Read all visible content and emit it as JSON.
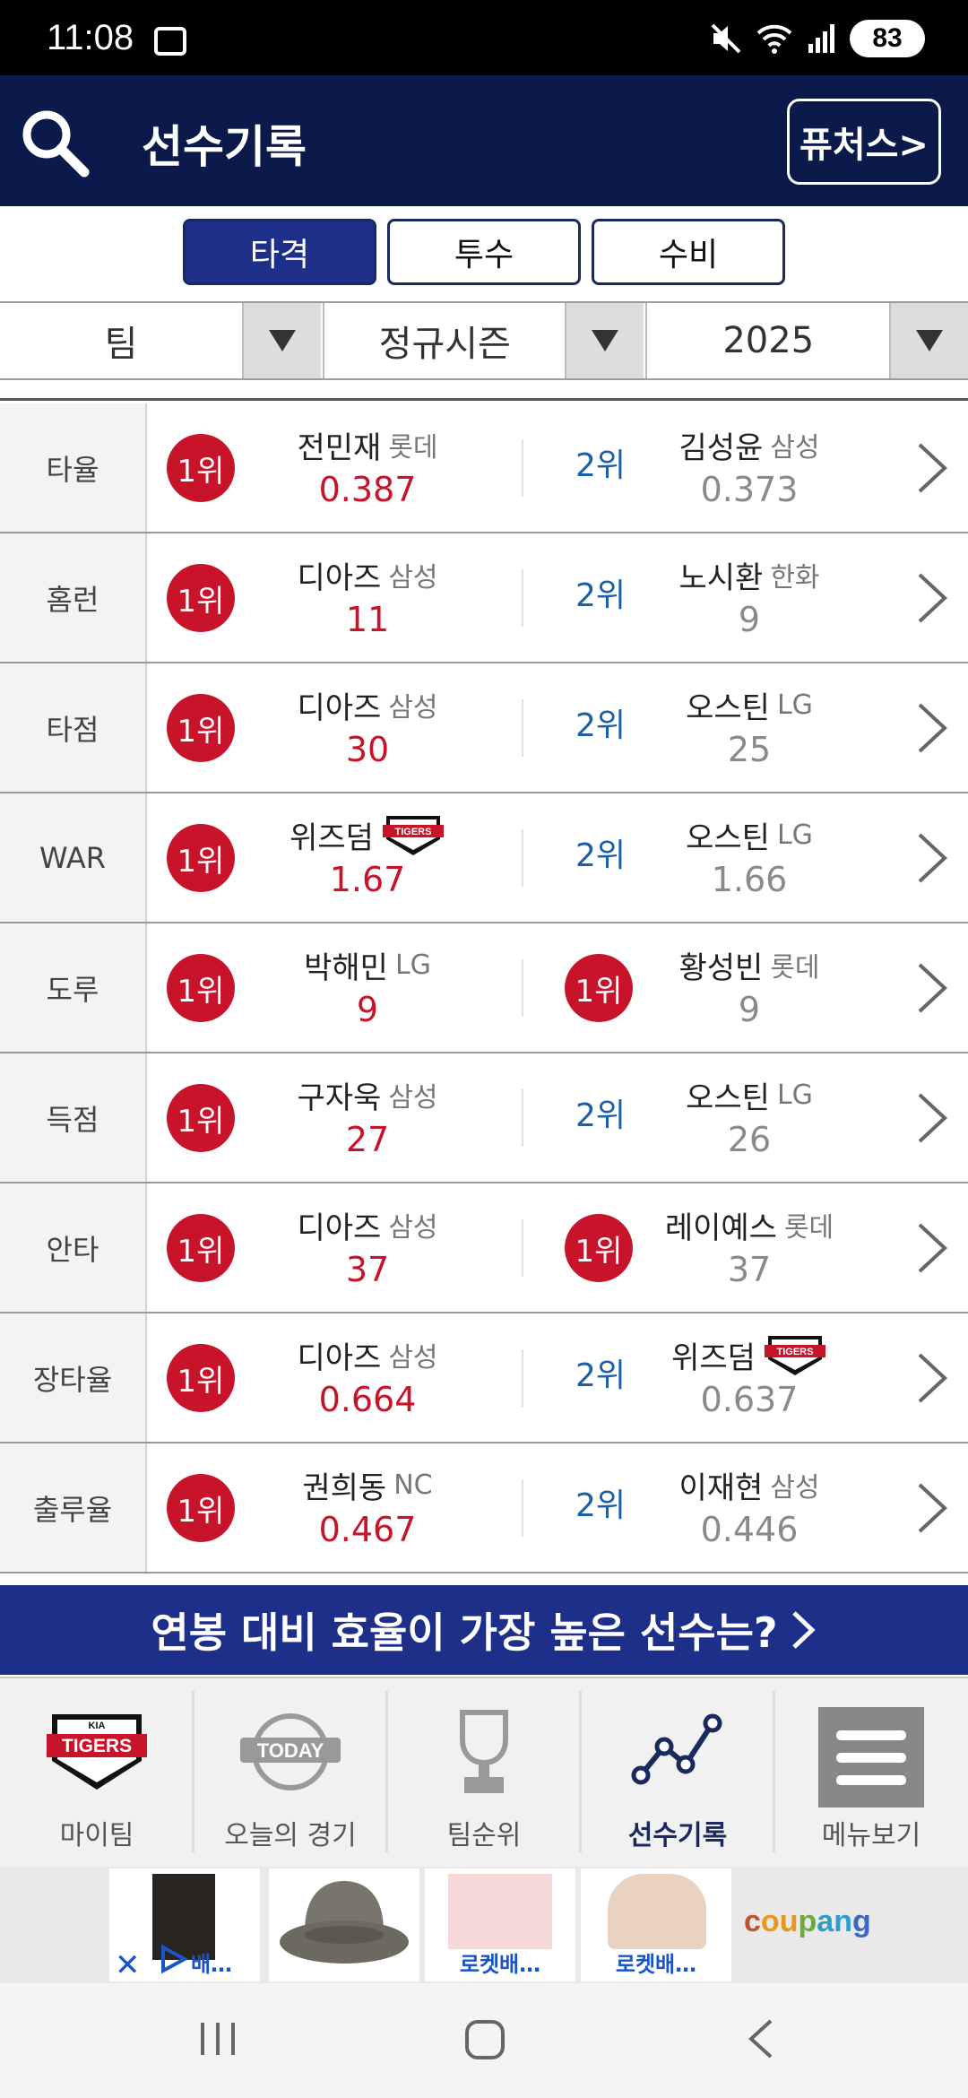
{
  "status_bar": {
    "time": "11:08",
    "battery": "83"
  },
  "header": {
    "title": "선수기록",
    "futures_label": "퓨처스>"
  },
  "tabs": [
    {
      "label": "타격",
      "active": true
    },
    {
      "label": "투수",
      "active": false
    },
    {
      "label": "수비",
      "active": false
    }
  ],
  "filters": {
    "team": "팀",
    "season": "정규시즌",
    "year": "2025"
  },
  "records": [
    {
      "category": "타율",
      "first": {
        "rank": "1위",
        "name": "전민재",
        "team": "롯데",
        "value": "0.387"
      },
      "second": {
        "rank": "2위",
        "name": "김성윤",
        "team": "삼성",
        "value": "0.373"
      }
    },
    {
      "category": "홈런",
      "first": {
        "rank": "1위",
        "name": "디아즈",
        "team": "삼성",
        "value": "11"
      },
      "second": {
        "rank": "2위",
        "name": "노시환",
        "team": "한화",
        "value": "9"
      }
    },
    {
      "category": "타점",
      "first": {
        "rank": "1위",
        "name": "디아즈",
        "team": "삼성",
        "value": "30"
      },
      "second": {
        "rank": "2위",
        "name": "오스틴",
        "team": "LG",
        "value": "25"
      }
    },
    {
      "category": "WAR",
      "first": {
        "rank": "1위",
        "name": "위즈덤",
        "team": "",
        "value": "1.67"
      },
      "second": {
        "rank": "2위",
        "name": "오스틴",
        "team": "LG",
        "value": "1.66"
      }
    },
    {
      "category": "도루",
      "first": {
        "rank": "1위",
        "name": "박해민",
        "team": "LG",
        "value": "9"
      },
      "second": {
        "rank": "1위",
        "name": "황성빈",
        "team": "롯데",
        "value": "9"
      }
    },
    {
      "category": "득점",
      "first": {
        "rank": "1위",
        "name": "구자욱",
        "team": "삼성",
        "value": "27"
      },
      "second": {
        "rank": "2위",
        "name": "오스틴",
        "team": "LG",
        "value": "26"
      }
    },
    {
      "category": "안타",
      "first": {
        "rank": "1위",
        "name": "디아즈",
        "team": "삼성",
        "value": "37"
      },
      "second": {
        "rank": "1위",
        "name": "레이예스",
        "team": "롯데",
        "value": "37"
      }
    },
    {
      "category": "장타율",
      "first": {
        "rank": "1위",
        "name": "디아즈",
        "team": "삼성",
        "value": "0.664"
      },
      "second": {
        "rank": "2위",
        "name": "위즈덤",
        "team": "",
        "value": "0.637"
      }
    },
    {
      "category": "출루율",
      "first": {
        "rank": "1위",
        "name": "권희동",
        "team": "NC",
        "value": "0.467"
      },
      "second": {
        "rank": "2위",
        "name": "이재현",
        "team": "삼성",
        "value": "0.446"
      }
    }
  ],
  "promo": {
    "text": "연봉 대비 효율이 가장 높은 선수는?"
  },
  "bottom_nav": [
    {
      "label": "마이팀",
      "icon": "tigers-logo-icon"
    },
    {
      "label": "오늘의 경기",
      "icon": "today-ball-icon"
    },
    {
      "label": "팀순위",
      "icon": "trophy-icon"
    },
    {
      "label": "선수기록",
      "icon": "line-chart-icon",
      "active": true
    },
    {
      "label": "메뉴보기",
      "icon": "menu-icon"
    }
  ],
  "ads": {
    "item1_caption": "배…",
    "item3_caption": "로켓배…",
    "item4_caption": "로켓배…",
    "brand": "coupang"
  },
  "colors": {
    "navy": "#0b1a4a",
    "accent_blue": "#1e2f8a",
    "rank_red": "#c8142a",
    "rank2_blue": "#1a5fa8"
  }
}
